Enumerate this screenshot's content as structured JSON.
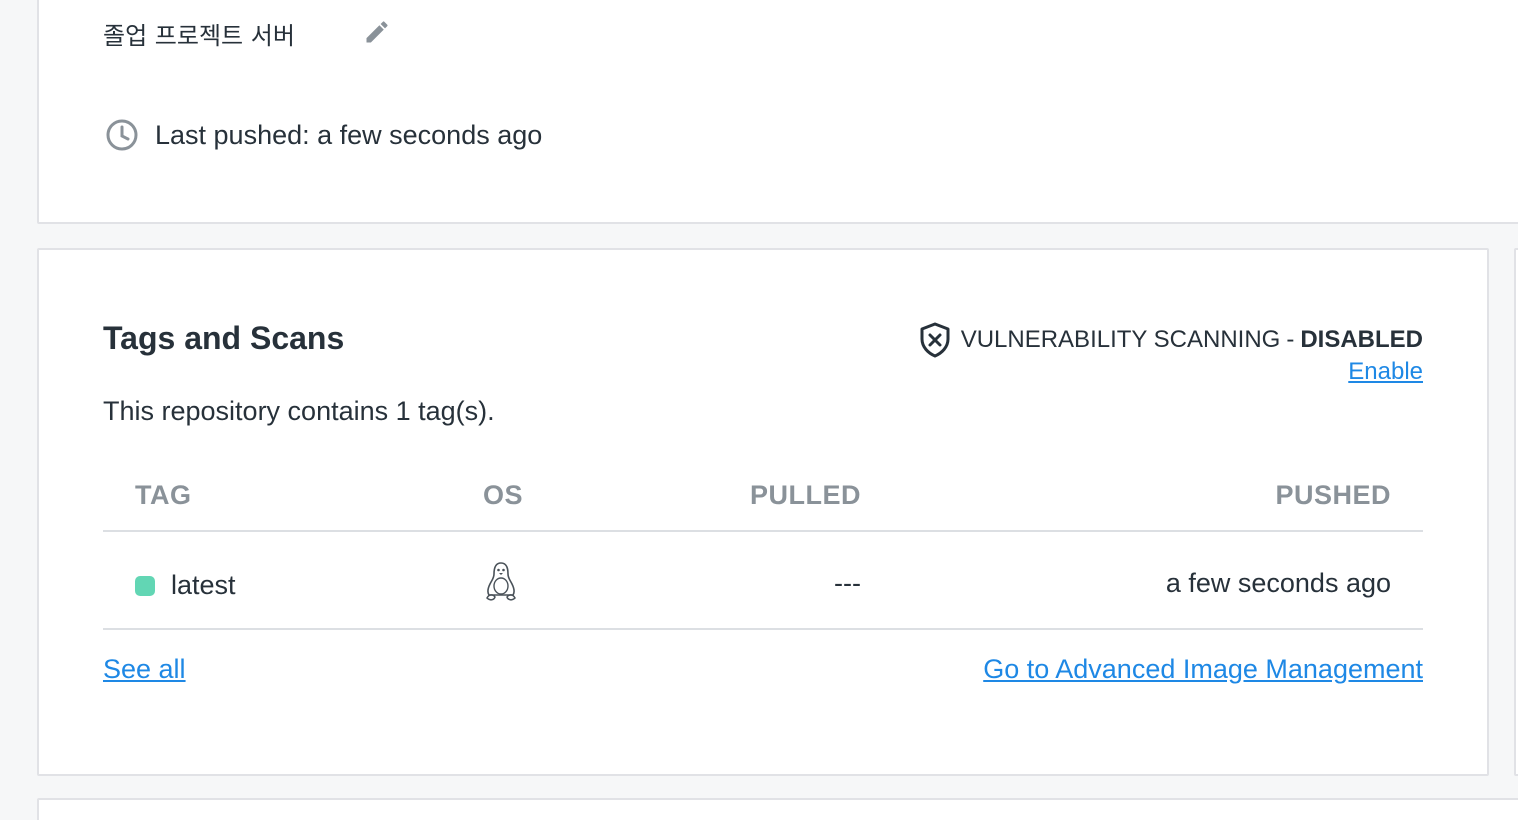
{
  "overview": {
    "description": "졸업 프로젝트 서버",
    "last_pushed": "Last pushed: a few seconds ago"
  },
  "tags_and_scans": {
    "title": "Tags and Scans",
    "scan_label": "VULNERABILITY SCANNING",
    "scan_dash": "-",
    "scan_status": "DISABLED",
    "enable_link": "Enable",
    "tag_count_text": "This repository contains 1 tag(s).",
    "columns": {
      "tag": "TAG",
      "os": "OS",
      "pulled": "PULLED",
      "pushed": "PUSHED"
    },
    "rows": [
      {
        "tag": "latest",
        "os_icon": "linux-icon",
        "pulled": "---",
        "pushed": "a few seconds ago",
        "status_color": "#62d6b4"
      }
    ],
    "see_all_link": "See all",
    "advanced_link": "Go to Advanced Image Management"
  },
  "colors": {
    "link": "#1e88e5",
    "text": "#27313a",
    "muted": "#8a9299",
    "status_ok": "#62d6b4"
  }
}
